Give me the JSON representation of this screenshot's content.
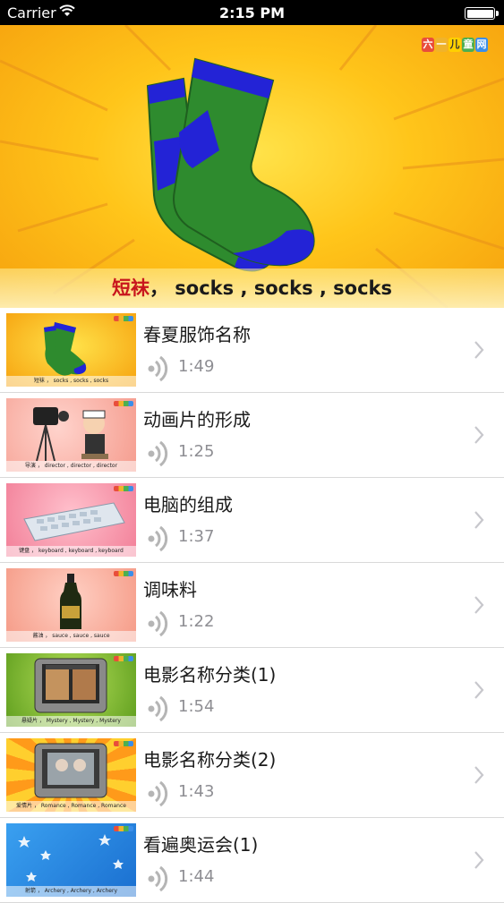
{
  "status_bar": {
    "carrier": "Carrier",
    "time": "2:15 PM"
  },
  "hero": {
    "logo_chars": [
      "六",
      "一",
      "儿",
      "童",
      "网"
    ],
    "caption_cn": "短袜",
    "caption_en": "，  socks , socks , socks"
  },
  "items": [
    {
      "title": "春夏服饰名称",
      "duration": "1:49",
      "thumb_caption": "短袜 ， socks , socks , socks"
    },
    {
      "title": "动画片的形成",
      "duration": "1:25",
      "thumb_caption": "导演 ， director , director , director"
    },
    {
      "title": "电脑的组成",
      "duration": "1:37",
      "thumb_caption": "键盘 ， keyboard , keyboard , keyboard"
    },
    {
      "title": "调味料",
      "duration": "1:22",
      "thumb_caption": "酱油 ， sauce , sauce , sauce"
    },
    {
      "title": "电影名称分类(1)",
      "duration": "1:54",
      "thumb_caption": "悬疑片 ， Mystery , Mystery , Mystery"
    },
    {
      "title": "电影名称分类(2)",
      "duration": "1:43",
      "thumb_caption": "爱情片 ， Romance , Romance , Romance"
    },
    {
      "title": "看遍奥运会(1)",
      "duration": "1:44",
      "thumb_caption": "射箭 ， Archery , Archery , Archery"
    }
  ],
  "colors": {
    "hero_bg": "#ffc51a",
    "sock_green": "#2e8b2e",
    "sock_blue": "#2323d6",
    "caption_red": "#c8161d",
    "chevron": "#c7c7cc",
    "duration_gray": "#8e8e93"
  },
  "icons": {
    "status": [
      "wifi-icon",
      "battery-icon"
    ],
    "row": [
      "audio-icon",
      "chevron-right-icon"
    ]
  }
}
